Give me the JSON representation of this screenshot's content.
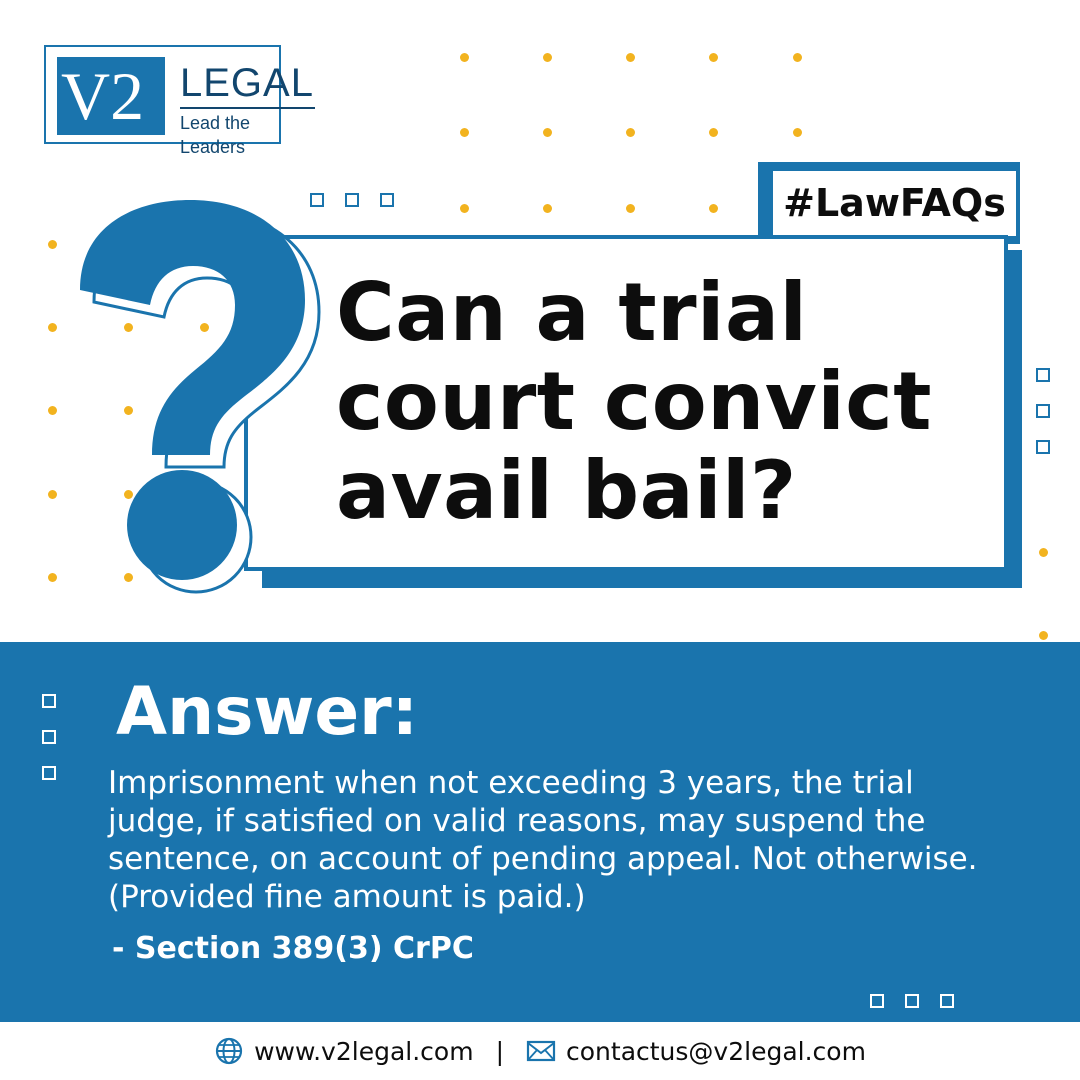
{
  "brand": {
    "mark": "V2",
    "name": "LEGAL",
    "tagline": "Lead the Leaders",
    "color": "#1a74ad",
    "accent_dot_color": "#f2b31f"
  },
  "hashtag": "#LawFAQs",
  "question": {
    "icon": "question-mark-icon",
    "lines": [
      "Can a trial",
      "court convict",
      "avail bail?"
    ]
  },
  "answer": {
    "title": "Answer:",
    "body": "Imprisonment when not exceeding 3 years, the trial judge, if satisfied on valid reasons, may suspend the sentence, on account of pending appeal. Not otherwise. (Provided fine amount is paid.)",
    "citation": "- Section 389(3) CrPC"
  },
  "footer": {
    "website": "www.v2legal.com",
    "website_icon": "globe-icon",
    "separator": "|",
    "email": "contactus@v2legal.com",
    "email_icon": "envelope-icon"
  }
}
